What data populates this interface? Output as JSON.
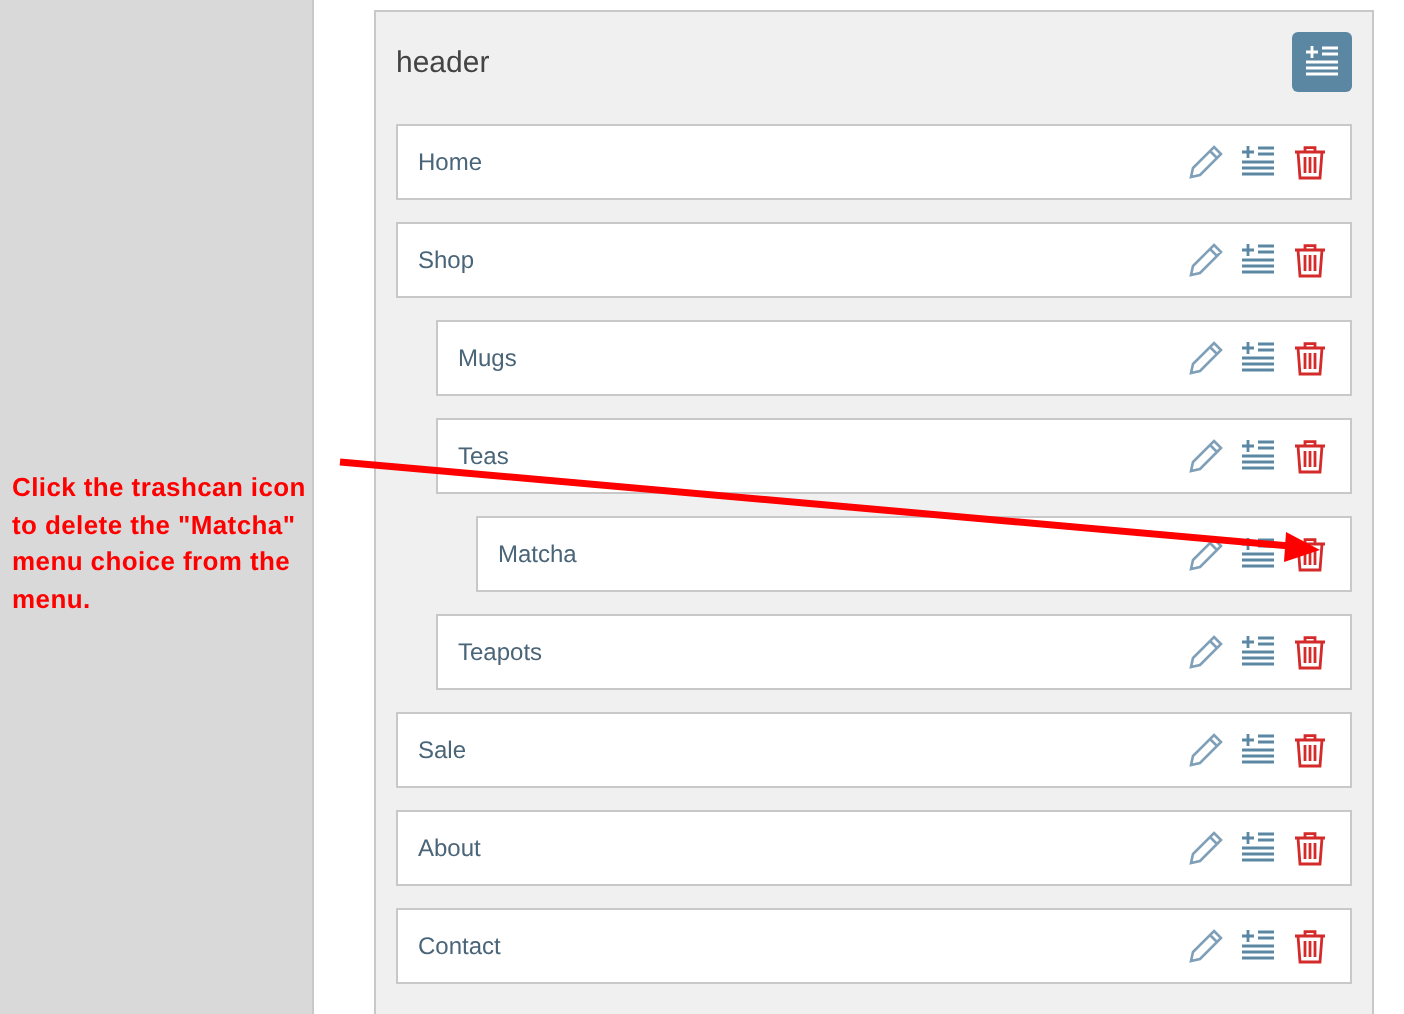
{
  "annotation": "Click the trashcan icon to delete the \"Matcha\" menu choice from the menu.",
  "header": {
    "title": "header"
  },
  "menu": [
    {
      "label": "Home"
    },
    {
      "label": "Shop",
      "children": [
        {
          "label": "Mugs"
        },
        {
          "label": "Teas",
          "children": [
            {
              "label": "Matcha"
            }
          ]
        },
        {
          "label": "Teapots"
        }
      ]
    },
    {
      "label": "Sale"
    },
    {
      "label": "About"
    },
    {
      "label": "Contact"
    }
  ]
}
